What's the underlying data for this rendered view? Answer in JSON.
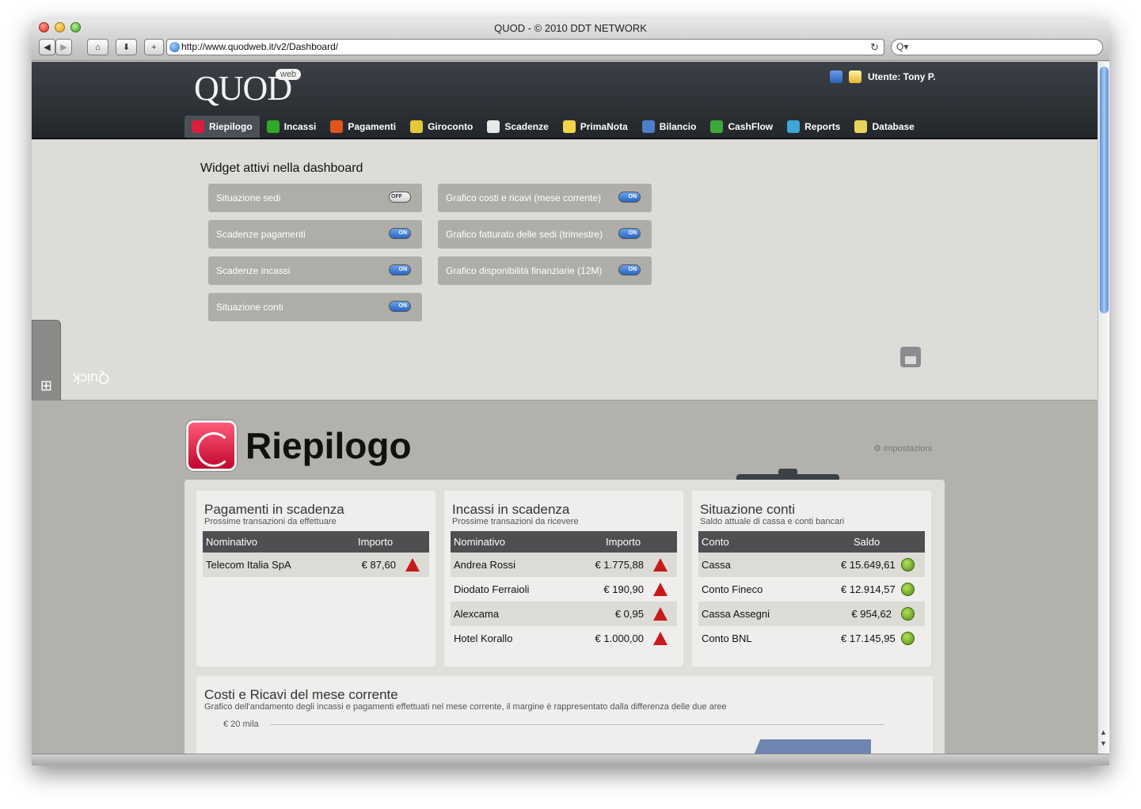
{
  "window": {
    "title": "QUOD - © 2010 DDT NETWORK",
    "url": "http://www.quodweb.it/v2/Dashboard/",
    "search_placeholder": "Q▾"
  },
  "header": {
    "logo": "QUOD",
    "logo_badge": "web",
    "user": "Utente: Tony P."
  },
  "menu": [
    {
      "label": "Riepilogo",
      "icon": "speedometer-icon",
      "color": "#d91e3e",
      "active": true
    },
    {
      "label": "Incassi",
      "icon": "plus-icon",
      "color": "#2fa829"
    },
    {
      "label": "Pagamenti",
      "icon": "minus-icon",
      "color": "#e1541c"
    },
    {
      "label": "Giroconto",
      "icon": "transfer-icon",
      "color": "#e3c93a"
    },
    {
      "label": "Scadenze",
      "icon": "calendar-icon",
      "color": "#e8e8e8"
    },
    {
      "label": "PrimaNota",
      "icon": "notepad-icon",
      "color": "#f2d54a"
    },
    {
      "label": "Bilancio",
      "icon": "calculator-icon",
      "color": "#4f7ec9"
    },
    {
      "label": "CashFlow",
      "icon": "chart-icon",
      "color": "#3ca83a"
    },
    {
      "label": "Reports",
      "icon": "pie-chart-icon",
      "color": "#3ea6d8"
    },
    {
      "label": "Database",
      "icon": "database-icon",
      "color": "#e7d35a"
    }
  ],
  "widgets": {
    "title": "Widget attivi nella dashboard",
    "left": [
      {
        "label": "Situazione sedi",
        "state": "OFF"
      },
      {
        "label": "Scadenze pagamenti",
        "state": "ON"
      },
      {
        "label": "Scadenze incassi",
        "state": "ON"
      },
      {
        "label": "Situazione conti",
        "state": "ON"
      }
    ],
    "right": [
      {
        "label": "Grafico costi e ricavi (mese corrente)",
        "state": "ON"
      },
      {
        "label": "Grafico fatturato delle sedi (trimestre)",
        "state": "ON"
      },
      {
        "label": "Grafico disponibilità finanziarie (12M)",
        "state": "ON"
      }
    ]
  },
  "quick_tab": "Quick",
  "riepilogo": {
    "title": "Riepilogo",
    "settings": "impostazioni"
  },
  "pagamenti": {
    "title": "Pagamenti in scadenza",
    "subtitle": "Prossime transazioni da effettuare",
    "col_name": "Nominativo",
    "col_amount": "Importo",
    "rows": [
      {
        "name": "Telecom Italia SpA",
        "amount": "€ 87,60"
      }
    ]
  },
  "incassi": {
    "title": "Incassi in scadenza",
    "subtitle": "Prossime transazioni da ricevere",
    "col_name": "Nominativo",
    "col_amount": "Importo",
    "rows": [
      {
        "name": "Andrea Rossi",
        "amount": "€ 1.775,88"
      },
      {
        "name": "Diodato Ferraioli",
        "amount": "€ 190,90"
      },
      {
        "name": "Alexcama",
        "amount": "€ 0,95"
      },
      {
        "name": "Hotel Korallo",
        "amount": "€ 1.000,00"
      }
    ]
  },
  "conti": {
    "title": "Situazione conti",
    "subtitle": "Saldo attuale di cassa e conti bancari",
    "col_name": "Conto",
    "col_amount": "Saldo",
    "rows": [
      {
        "name": "Cassa",
        "amount": "€ 15.649,61"
      },
      {
        "name": "Conto Fineco",
        "amount": "€ 12.914,57"
      },
      {
        "name": "Cassa Assegni",
        "amount": "€ 954,62"
      },
      {
        "name": "Conto BNL",
        "amount": "€ 17.145,95"
      }
    ]
  },
  "costi_ricavi": {
    "title": "Costi e Ricavi del mese corrente",
    "subtitle": "Grafico dell'andamento degli incassi e pagamenti effettuati nel mese corrente, il margine è rappresentato dalla differenza delle due aree",
    "y_tick": "€ 20 mila"
  }
}
